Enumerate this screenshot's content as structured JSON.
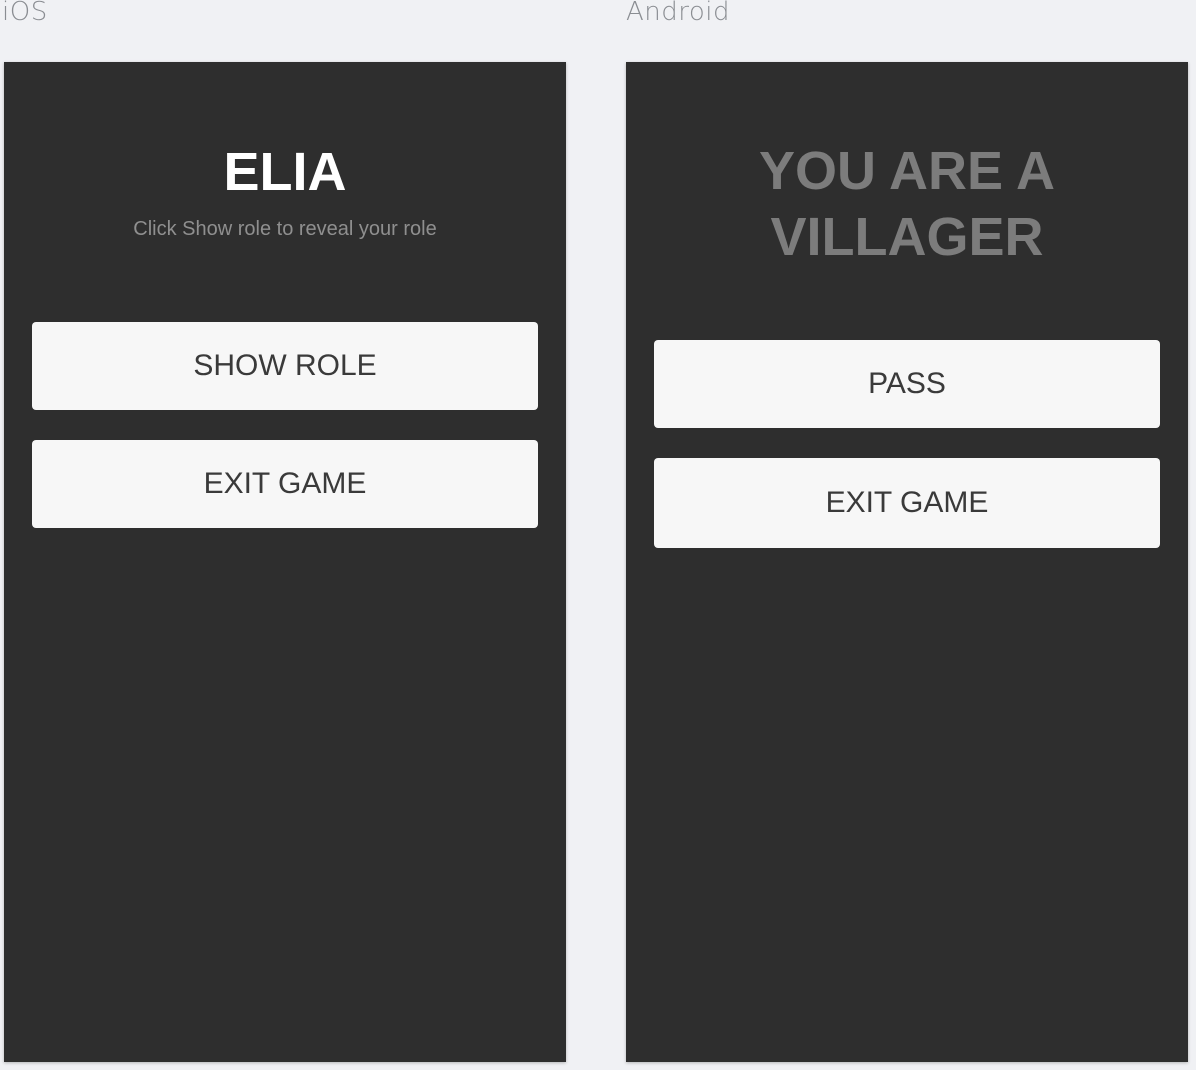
{
  "labels": {
    "ios": "iOS",
    "android": "Android"
  },
  "ios_screen": {
    "title": "ELIA",
    "subtitle": "Click Show role to reveal your role",
    "show_role_label": "SHOW ROLE",
    "exit_game_label": "EXIT GAME"
  },
  "android_screen": {
    "title": "YOU ARE A VILLAGER",
    "pass_label": "PASS",
    "exit_game_label": "EXIT GAME"
  },
  "colors": {
    "page_background": "#f0f1f4",
    "screen_background": "#2e2e2e",
    "button_background": "#f7f7f7",
    "button_text": "#3a3a3a",
    "ios_title": "#ffffff",
    "android_title": "#7c7c7c",
    "subtitle": "#8f8f8f"
  }
}
